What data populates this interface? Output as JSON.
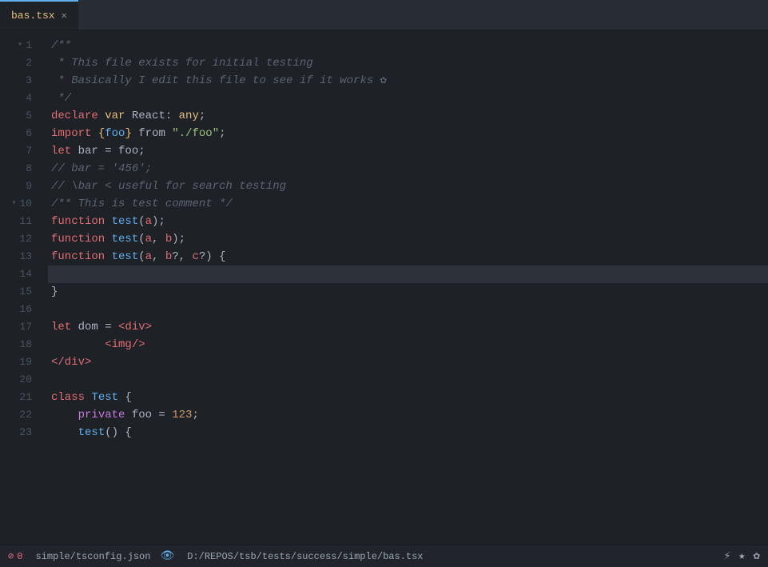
{
  "tab": {
    "filename": "bas.tsx",
    "close_label": "✕"
  },
  "lines": [
    {
      "num": 1,
      "fold": true,
      "tokens": [
        {
          "t": "comment",
          "v": "/**"
        }
      ]
    },
    {
      "num": 2,
      "fold": false,
      "tokens": [
        {
          "t": "comment",
          "v": " * This file exists for initial testing"
        }
      ]
    },
    {
      "num": 3,
      "fold": false,
      "tokens": [
        {
          "t": "comment",
          "v": " * Basically I edit this file to see if it works"
        },
        {
          "t": "flower",
          "v": " ✿"
        }
      ]
    },
    {
      "num": 4,
      "fold": false,
      "tokens": [
        {
          "t": "comment",
          "v": " */"
        }
      ]
    },
    {
      "num": 5,
      "fold": false,
      "tokens": [
        {
          "t": "declare",
          "v": "declare"
        },
        {
          "t": "white",
          "v": " "
        },
        {
          "t": "var",
          "v": "var"
        },
        {
          "t": "white",
          "v": " React: "
        },
        {
          "t": "any",
          "v": "any"
        },
        {
          "t": "white",
          "v": ";"
        }
      ]
    },
    {
      "num": 6,
      "fold": false,
      "tokens": [
        {
          "t": "import",
          "v": "import"
        },
        {
          "t": "white",
          "v": " "
        },
        {
          "t": "brace",
          "v": "{"
        },
        {
          "t": "fn",
          "v": "foo"
        },
        {
          "t": "brace",
          "v": "}"
        },
        {
          "t": "white",
          "v": " from "
        },
        {
          "t": "string",
          "v": "\"./foo\""
        },
        {
          "t": "white",
          "v": ";"
        }
      ]
    },
    {
      "num": 7,
      "fold": false,
      "tokens": [
        {
          "t": "let",
          "v": "let"
        },
        {
          "t": "white",
          "v": " bar = foo;"
        }
      ]
    },
    {
      "num": 8,
      "fold": false,
      "tokens": [
        {
          "t": "comment",
          "v": "// bar = '456';"
        }
      ]
    },
    {
      "num": 9,
      "fold": false,
      "tokens": [
        {
          "t": "comment",
          "v": "// \\bar < useful for search testing"
        }
      ]
    },
    {
      "num": 10,
      "fold": true,
      "tokens": [
        {
          "t": "comment",
          "v": "/** This is test comment */"
        }
      ]
    },
    {
      "num": 11,
      "fold": false,
      "tokens": [
        {
          "t": "keyword",
          "v": "function"
        },
        {
          "t": "white",
          "v": " "
        },
        {
          "t": "fn",
          "v": "test"
        },
        {
          "t": "white",
          "v": "("
        },
        {
          "t": "param",
          "v": "a"
        },
        {
          "t": "white",
          "v": ");"
        }
      ]
    },
    {
      "num": 12,
      "fold": false,
      "tokens": [
        {
          "t": "keyword",
          "v": "function"
        },
        {
          "t": "white",
          "v": " "
        },
        {
          "t": "fn",
          "v": "test"
        },
        {
          "t": "white",
          "v": "("
        },
        {
          "t": "param",
          "v": "a"
        },
        {
          "t": "white",
          "v": ", "
        },
        {
          "t": "param",
          "v": "b"
        },
        {
          "t": "white",
          "v": ");"
        }
      ]
    },
    {
      "num": 13,
      "fold": false,
      "tokens": [
        {
          "t": "keyword",
          "v": "function"
        },
        {
          "t": "white",
          "v": " "
        },
        {
          "t": "fn",
          "v": "test"
        },
        {
          "t": "white",
          "v": "("
        },
        {
          "t": "param",
          "v": "a"
        },
        {
          "t": "white",
          "v": ", "
        },
        {
          "t": "param",
          "v": "b"
        },
        {
          "t": "white",
          "v": "?, "
        },
        {
          "t": "param",
          "v": "c"
        },
        {
          "t": "white",
          "v": "?) {"
        }
      ]
    },
    {
      "num": 14,
      "fold": false,
      "highlight": true,
      "tokens": []
    },
    {
      "num": 15,
      "fold": false,
      "tokens": [
        {
          "t": "white",
          "v": "}"
        }
      ]
    },
    {
      "num": 16,
      "fold": false,
      "tokens": []
    },
    {
      "num": 17,
      "fold": false,
      "tokens": [
        {
          "t": "let",
          "v": "let"
        },
        {
          "t": "white",
          "v": " dom = "
        },
        {
          "t": "jsx",
          "v": "<div>"
        }
      ]
    },
    {
      "num": 18,
      "fold": false,
      "tokens": [
        {
          "t": "jsx",
          "v": "        <img/>"
        }
      ]
    },
    {
      "num": 19,
      "fold": false,
      "tokens": [
        {
          "t": "jsx",
          "v": "</div>"
        }
      ]
    },
    {
      "num": 20,
      "fold": false,
      "tokens": []
    },
    {
      "num": 21,
      "fold": false,
      "tokens": [
        {
          "t": "class",
          "v": "class"
        },
        {
          "t": "white",
          "v": " "
        },
        {
          "t": "fn",
          "v": "Test"
        },
        {
          "t": "white",
          "v": " {"
        }
      ]
    },
    {
      "num": 22,
      "fold": false,
      "tokens": [
        {
          "t": "white",
          "v": "    "
        },
        {
          "t": "private",
          "v": "private"
        },
        {
          "t": "white",
          "v": " foo = "
        },
        {
          "t": "number",
          "v": "123"
        },
        {
          "t": "white",
          "v": ";"
        }
      ]
    },
    {
      "num": 23,
      "fold": false,
      "tokens": [
        {
          "t": "white",
          "v": "    "
        },
        {
          "t": "fn",
          "v": "test"
        },
        {
          "t": "white",
          "v": "() {"
        }
      ]
    }
  ],
  "status": {
    "error_icon": "⊘",
    "error_count": "0",
    "config_file": "simple/tsconfig.json",
    "eye_icon": "👁",
    "file_path": "D:/REPOS/tsb/tests/success/simple/bas.tsx",
    "bolt_icon": "⚡",
    "star_icon": "★",
    "flower_icon": "✿"
  }
}
